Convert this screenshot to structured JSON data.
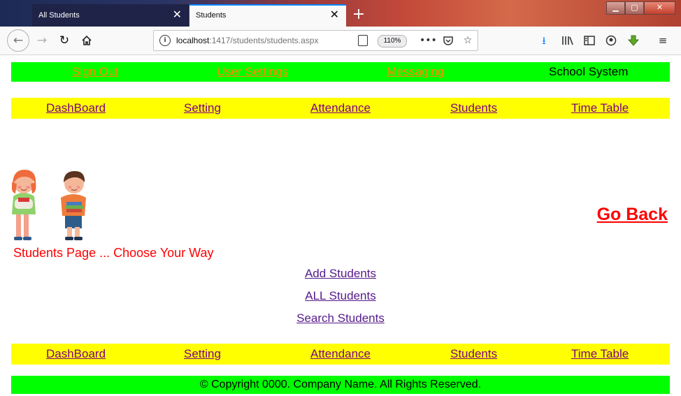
{
  "browser": {
    "tabs": [
      {
        "title": "All Students",
        "active": false
      },
      {
        "title": "Students",
        "active": true
      }
    ],
    "new_tab_icon": "+",
    "close_icon": "✕",
    "url_host": "localhost",
    "url_path": ":1417/students/students.aspx",
    "zoom": "110%",
    "toolbar_icons": [
      "download-icon",
      "library-icon",
      "sidebar-icon",
      "account-icon",
      "extension-icon",
      "menu-icon"
    ]
  },
  "top_nav": {
    "links": [
      "Sign Out",
      "User Settings",
      "Messaging"
    ],
    "system_name": "School System",
    "link_color": "#ff8c00",
    "background": "#00ff00"
  },
  "main_menu": {
    "items": [
      "DashBoard",
      "Setting",
      "Attendance",
      "Students",
      "Time Table"
    ],
    "background": "#ffff00",
    "link_color": "#800080"
  },
  "content": {
    "go_back": "Go Back",
    "caption": "Students Page ... Choose Your Way",
    "actions": [
      "Add Students",
      "ALL Students",
      "Search Students"
    ]
  },
  "footer": {
    "text": "© Copyright 0000. Company Name. All Rights Reserved."
  }
}
